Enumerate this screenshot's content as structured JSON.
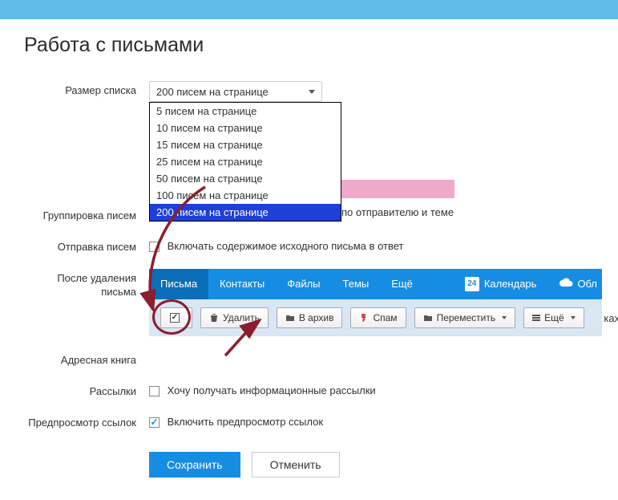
{
  "title": "Работа с письмами",
  "labels": {
    "list_size": "Размер списка",
    "grouping": "Группировка писем",
    "sending": "Отправка писем",
    "after_delete": "После удаления письма",
    "address_book": "Адресная книга",
    "mailings": "Рассылки",
    "preview": "Предпросмотр ссылок"
  },
  "list_size": {
    "selected": "200 писем на странице",
    "options": [
      "5 писем на странице",
      "10 писем на странице",
      "15 писем на странице",
      "25 писем на странице",
      "50 писем на странице",
      "100 писем на странице",
      "200 писем на странице"
    ]
  },
  "grouping_text": "по отправителю и теме",
  "sending_text": "Включать содержимое исходного письма в ответ",
  "mailings_text": "Хочу получать информационные рассылки",
  "preview_text": "Включить предпросмотр ссылок",
  "mail_nav": {
    "messages": "Письма",
    "contacts": "Контакты",
    "files": "Файлы",
    "themes": "Темы",
    "more": "Ещё",
    "calendar": "Календарь",
    "calendar_day": "24",
    "cloud": "Обл"
  },
  "toolbar": {
    "delete": "Удалить",
    "archive": "В архив",
    "spam": "Спам",
    "move": "Переместить",
    "more": "Ещё"
  },
  "address_trailing": "ках при н",
  "buttons": {
    "save": "Сохранить",
    "cancel": "Отменить"
  }
}
